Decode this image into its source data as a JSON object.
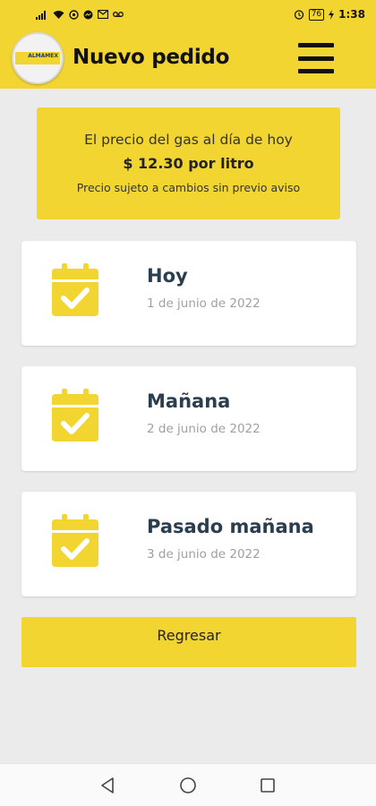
{
  "status_bar": {
    "left_icons": [
      "signal-icon",
      "wifi-icon",
      "whatsapp-icon",
      "messenger-icon",
      "mail-icon",
      "voicemail-icon"
    ],
    "battery": "76",
    "time": "1:38"
  },
  "header": {
    "title": "Nuevo pedido",
    "logo_text": "ALMAMEX",
    "colors": {
      "brand": "#f3d531",
      "dark": "#111111"
    }
  },
  "price": {
    "title": "El precio del gas al día de hoy",
    "value": "$  12.30 por litro",
    "note": "Precio sujeto a cambios sin previo aviso"
  },
  "days": [
    {
      "label": "Hoy",
      "date": "1 de junio de 2022",
      "icon": "calendar-check-icon"
    },
    {
      "label": "Mañana",
      "date": "2 de junio de 2022",
      "icon": "calendar-check-icon"
    },
    {
      "label": "Pasado mañana",
      "date": "3 de junio de 2022",
      "icon": "calendar-check-icon"
    }
  ],
  "back_label": "Regresar",
  "nav": [
    "back-icon",
    "home-icon",
    "recents-icon"
  ]
}
